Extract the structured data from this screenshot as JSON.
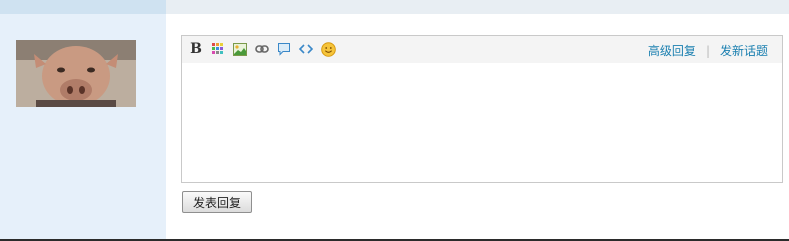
{
  "avatar": {
    "alt": "User avatar"
  },
  "toolbar": {
    "icons": [
      "bold-icon",
      "color-grid-icon",
      "image-icon",
      "link-icon",
      "quote-icon",
      "code-icon",
      "smiley-icon"
    ],
    "bold_label": "B"
  },
  "links": {
    "advanced_reply": "高级回复",
    "separator": "|",
    "new_topic": "发新话题"
  },
  "editor": {
    "value": ""
  },
  "submit": {
    "label": "发表回复"
  },
  "colors": {
    "accent_link": "#1a7fb0",
    "sidebar_bg": "#e6f0fa"
  }
}
